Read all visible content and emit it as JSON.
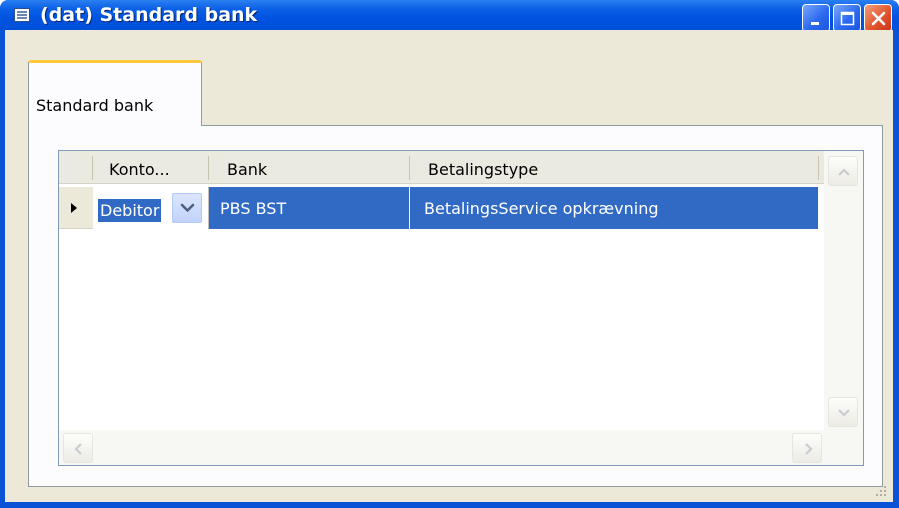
{
  "window": {
    "title": "(dat) Standard bank",
    "buttons": [
      "minimize-icon",
      "maximize-icon",
      "close-icon"
    ],
    "colors": {
      "titlebar": "#0054E3",
      "frame": "#0A52D6",
      "close": "#E2572E",
      "face": "#ECE9D8"
    }
  },
  "tab": {
    "label": "Standard bank",
    "accent": "#FFC83C"
  },
  "table": {
    "columns": [
      {
        "label": "Konto..."
      },
      {
        "label": "Bank"
      },
      {
        "label": "Betalingstype"
      }
    ],
    "rows": [
      {
        "konto": "Debitor",
        "bank": "PBS BST",
        "betalingstype": "BetalingsService opkrævning",
        "selected": true
      }
    ],
    "selection_color": "#316AC5",
    "dropdown_icon": "chevron-down-icon",
    "row_indicator_icon": "row-pointer-icon"
  },
  "scrollbars": {
    "vertical": [
      "scroll-up-icon",
      "scroll-down-icon"
    ],
    "horizontal": [
      "scroll-left-icon",
      "scroll-right-icon"
    ]
  }
}
